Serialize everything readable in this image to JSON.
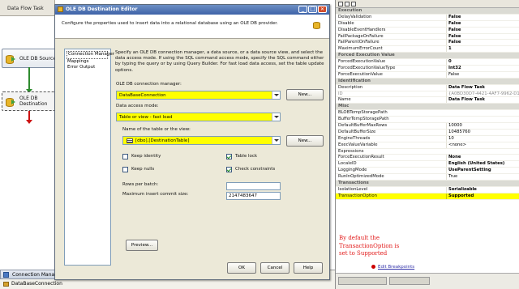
{
  "designer": {
    "tab_label": "Data Flow Task",
    "source_label": "OLE DB Source",
    "destination_label": "OLE DB\nDestination",
    "connection_managers_title": "Connection Managers",
    "connection_item": "DataBaseConnection"
  },
  "dialog": {
    "title": "OLE DB Destination Editor",
    "description": "Configure the properties used to insert data into a relational database using an OLE DB provider.",
    "nav_items": [
      "Connection Manager",
      "Mappings",
      "Error Output"
    ],
    "content_text": "Specify an OLE DB connection manager, a data source, or a data source view, and select the data access mode. If using the SQL command access mode, specify the SQL command either by typing the query or by using Query Builder. For fast load data access, set the table update options.",
    "conn_mgr_label": "OLE DB connection manager:",
    "conn_mgr_value": "DataBaseConnection",
    "new_button": "New...",
    "access_mode_label": "Data access mode:",
    "access_mode_value": "Table or view - fast load",
    "table_label": "Name of the table or the view:",
    "table_value": "[dbo].[DestinationTable]",
    "keep_identity": "Keep identity",
    "table_lock": "Table lock",
    "keep_nulls": "Keep nulls",
    "check_constraints": "Check constraints",
    "rows_batch_label": "Rows per batch:",
    "rows_batch_value": "",
    "max_commit_label": "Maximum insert commit size:",
    "max_commit_value": "2147483647",
    "preview_button": "Preview...",
    "ok_button": "OK",
    "cancel_button": "Cancel",
    "help_button": "Help",
    "checks": {
      "keep_identity": false,
      "table_lock": true,
      "keep_nulls": false,
      "check_constraints": true
    }
  },
  "properties": {
    "rows": [
      {
        "type": "cat",
        "name": "Execution"
      },
      {
        "name": "DelayValidation",
        "value": "False",
        "bold": true
      },
      {
        "name": "Disable",
        "value": "False",
        "bold": true
      },
      {
        "name": "DisableEventHandlers",
        "value": "False",
        "bold": true
      },
      {
        "name": "FailPackageOnFailure",
        "value": "False",
        "bold": true
      },
      {
        "name": "FailParentOnFailure",
        "value": "False",
        "bold": true
      },
      {
        "name": "MaximumErrorCount",
        "value": "1",
        "bold": true
      },
      {
        "type": "cat",
        "name": "Forced Execution Value"
      },
      {
        "name": "ForcedExecutionValue",
        "value": "0",
        "bold": true
      },
      {
        "name": "ForcedExecutionValueType",
        "value": "Int32",
        "bold": true
      },
      {
        "name": "ForceExecutionValue",
        "value": "False",
        "bold": false
      },
      {
        "type": "cat",
        "name": "Identification"
      },
      {
        "name": "Description",
        "value": "Data Flow Task",
        "bold": true
      },
      {
        "name": "ID",
        "value": "{A0BD30D7-4421-4AF7-9962-D1AF9",
        "bold": false,
        "grey": true
      },
      {
        "name": "Name",
        "value": "Data Flow Task",
        "bold": true
      },
      {
        "type": "cat",
        "name": "Misc"
      },
      {
        "name": "BLOBTempStoragePath",
        "value": "",
        "bold": false
      },
      {
        "name": "BufferTempStoragePath",
        "value": "",
        "bold": false
      },
      {
        "name": "DefaultBufferMaxRows",
        "value": "10000",
        "bold": false
      },
      {
        "name": "DefaultBufferSize",
        "value": "10485760",
        "bold": false
      },
      {
        "name": "EngineThreads",
        "value": "10",
        "bold": false
      },
      {
        "name": "ExecValueVariable",
        "value": "<none>",
        "bold": false
      },
      {
        "name": "Expressions",
        "value": "",
        "bold": false
      },
      {
        "name": "ForceExecutionResult",
        "value": "None",
        "bold": true
      },
      {
        "name": "LocaleID",
        "value": "English (United States)",
        "bold": true
      },
      {
        "name": "LoggingMode",
        "value": "UseParentSetting",
        "bold": true
      },
      {
        "name": "RunInOptimizedMode",
        "value": "True",
        "bold": false
      },
      {
        "type": "cat",
        "name": "Transactions"
      },
      {
        "name": "IsolationLevel",
        "value": "Serializable",
        "bold": true
      },
      {
        "name": "TransactionOption",
        "value": "Supported",
        "bold": true,
        "highlight": true
      }
    ],
    "note": "By default the TransactionOption is set to Supported",
    "breakpoints_link": "Edit Breakpoints"
  },
  "colors": {
    "highlight": "#ffff00",
    "note_red": "#e21b1b",
    "title_blue": "#3e63a8"
  }
}
